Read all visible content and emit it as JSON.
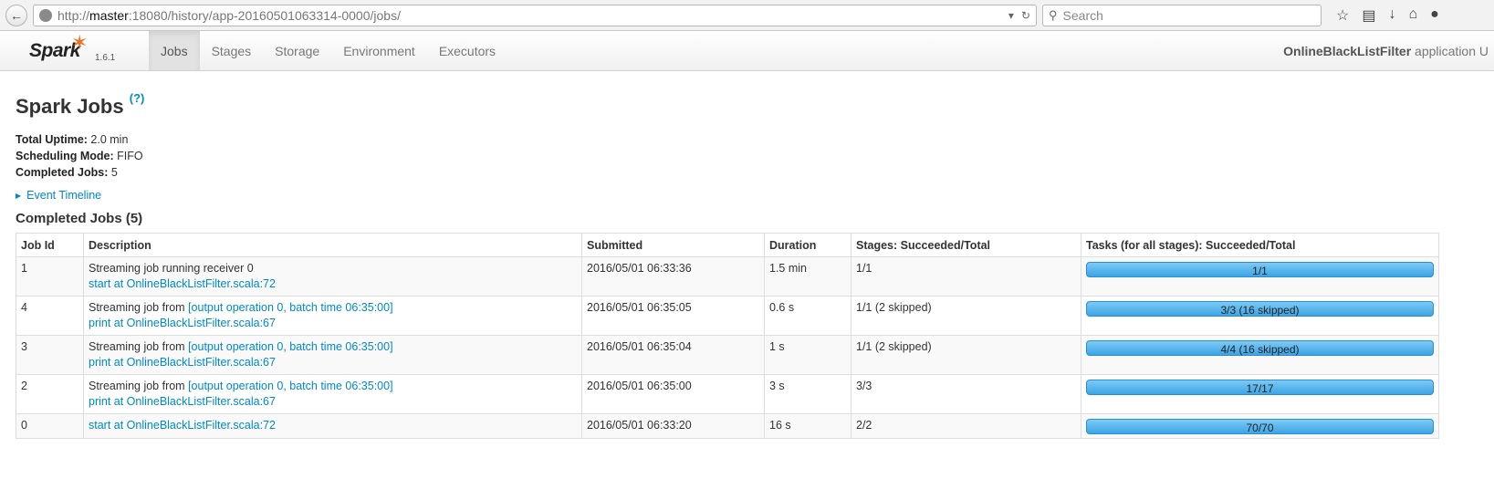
{
  "browser": {
    "url_prefix": "http://",
    "url_host": "master",
    "url_rest": ":18080/history/app-20160501063314-0000/jobs/",
    "search_placeholder": "Search"
  },
  "nav": {
    "brand": "Spark",
    "version": "1.6.1",
    "tabs": [
      "Jobs",
      "Stages",
      "Storage",
      "Environment",
      "Executors"
    ],
    "active_tab": "Jobs",
    "app_name": "OnlineBlackListFilter",
    "app_suffix": " application U"
  },
  "page": {
    "title": "Spark Jobs",
    "help": "(?)",
    "uptime_label": "Total Uptime:",
    "uptime_value": " 2.0 min",
    "mode_label": "Scheduling Mode:",
    "mode_value": " FIFO",
    "completed_label": "Completed Jobs:",
    "completed_value": " 5",
    "event_timeline": "Event Timeline",
    "section_title": "Completed Jobs (5)"
  },
  "table": {
    "headers": [
      "Job Id",
      "Description",
      "Submitted",
      "Duration",
      "Stages: Succeeded/Total",
      "Tasks (for all stages): Succeeded/Total"
    ],
    "rows": [
      {
        "id": "1",
        "desc_prefix": "Streaming job running receiver 0",
        "desc_link": "",
        "desc_sub": "start at OnlineBlackListFilter.scala:72",
        "submitted": "2016/05/01 06:33:36",
        "duration": "1.5 min",
        "stages": "1/1",
        "tasks": "1/1",
        "tasks_fraction": 1.0
      },
      {
        "id": "4",
        "desc_prefix": "Streaming job from ",
        "desc_link": "[output operation 0, batch time 06:35:00]",
        "desc_sub": "print at OnlineBlackListFilter.scala:67",
        "submitted": "2016/05/01 06:35:05",
        "duration": "0.6 s",
        "stages": "1/1 (2 skipped)",
        "tasks": "3/3 (16 skipped)",
        "tasks_fraction": 1.0
      },
      {
        "id": "3",
        "desc_prefix": "Streaming job from ",
        "desc_link": "[output operation 0, batch time 06:35:00]",
        "desc_sub": "print at OnlineBlackListFilter.scala:67",
        "submitted": "2016/05/01 06:35:04",
        "duration": "1 s",
        "stages": "1/1 (2 skipped)",
        "tasks": "4/4 (16 skipped)",
        "tasks_fraction": 1.0
      },
      {
        "id": "2",
        "desc_prefix": "Streaming job from ",
        "desc_link": "[output operation 0, batch time 06:35:00]",
        "desc_sub": "print at OnlineBlackListFilter.scala:67",
        "submitted": "2016/05/01 06:35:00",
        "duration": "3 s",
        "stages": "3/3",
        "tasks": "17/17",
        "tasks_fraction": 1.0
      },
      {
        "id": "0",
        "desc_prefix": "",
        "desc_link": "",
        "desc_sub": "start at OnlineBlackListFilter.scala:72",
        "submitted": "2016/05/01 06:33:20",
        "duration": "16 s",
        "stages": "2/2",
        "tasks": "70/70",
        "tasks_fraction": 1.0
      }
    ]
  }
}
